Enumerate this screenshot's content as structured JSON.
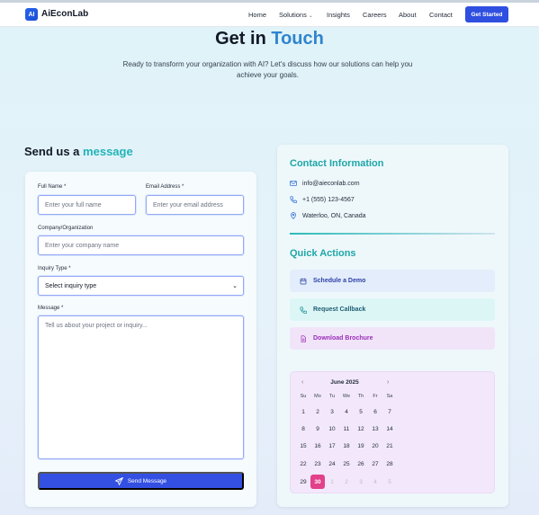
{
  "nav": {
    "logo_badge": "AI",
    "brand": "AiEconLab",
    "links": [
      {
        "label": "Home"
      },
      {
        "label": "Solutions"
      },
      {
        "label": "Insights"
      },
      {
        "label": "Careers"
      },
      {
        "label": "About"
      },
      {
        "label": "Contact"
      }
    ],
    "cta": "Get Started"
  },
  "hero": {
    "title_plain": "Get in",
    "title_accent": "Touch",
    "subtitle": "Ready to transform your organization with AI? Let's discuss how our solutions can help you achieve your goals."
  },
  "form": {
    "heading_plain": "Send us a",
    "heading_accent": "message",
    "full_name_label": "Full Name *",
    "full_name_placeholder": "Enter your full name",
    "email_label": "Email Address *",
    "email_placeholder": "Enter your email address",
    "company_label": "Company/Organization",
    "company_placeholder": "Enter your company name",
    "inquiry_label": "Inquiry Type *",
    "inquiry_value": "Select inquiry type",
    "message_label": "Message *",
    "message_placeholder": "Tell us about your project or inquiry...",
    "submit": "Send Message"
  },
  "contact": {
    "title": "Contact Information",
    "email": "info@aieconlab.com",
    "phone": "+1 (555) 123-4567",
    "location": "Waterloo, ON, Canada"
  },
  "quick_actions": {
    "title": "Quick Actions",
    "items": [
      {
        "label": "Schedule a Demo",
        "color": "#2c3fa8",
        "bg": "#e3edfb"
      },
      {
        "label": "Request Callback",
        "color": "#1f5e73",
        "bg": "#dcf6f6"
      },
      {
        "label": "Download Brochure",
        "color": "#9a2fb8",
        "bg": "#f1e4f9"
      }
    ]
  },
  "calendar": {
    "month": "June 2025",
    "prev": "‹",
    "next": "›",
    "weekdays": [
      "Su",
      "Mo",
      "Tu",
      "We",
      "Th",
      "Fr",
      "Sa"
    ],
    "weeks": [
      [
        "1",
        "2",
        "3",
        "4",
        "5",
        "6",
        "7"
      ],
      [
        "8",
        "9",
        "10",
        "11",
        "12",
        "13",
        "14"
      ],
      [
        "15",
        "16",
        "17",
        "18",
        "19",
        "20",
        "21"
      ],
      [
        "22",
        "23",
        "24",
        "25",
        "26",
        "27",
        "28"
      ],
      [
        "29",
        "30",
        "1",
        "2",
        "3",
        "4",
        "5"
      ]
    ],
    "selected": "30"
  },
  "colors": {
    "accent_blue": "#2f84cf",
    "accent_teal": "#22b3b8",
    "primary_button": "#3350e3",
    "selected_day": "#e2408a"
  }
}
